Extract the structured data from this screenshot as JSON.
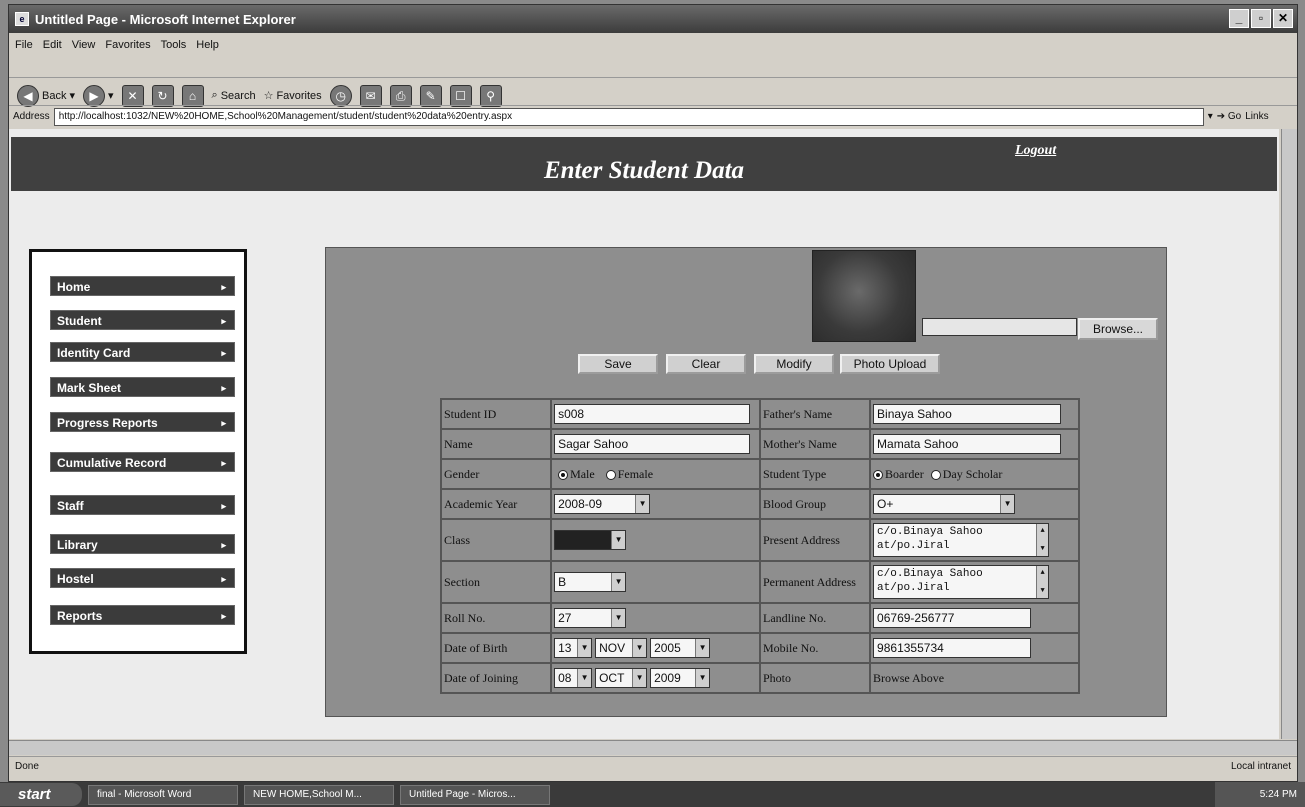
{
  "window": {
    "title": "Untitled Page - Microsoft Internet Explorer"
  },
  "menu": [
    "File",
    "Edit",
    "View",
    "Favorites",
    "Tools",
    "Help"
  ],
  "toolbar": {
    "back": "Back",
    "search": "Search",
    "favorites": "Favorites"
  },
  "address": {
    "label": "Address",
    "url": "http://localhost:1032/NEW%20HOME,School%20Management/student/student%20data%20entry.aspx",
    "go": "Go",
    "links": "Links"
  },
  "page": {
    "title": "Enter Student Data",
    "logout": "Logout"
  },
  "sidebar": {
    "items": [
      {
        "label": "Home"
      },
      {
        "label": "Student"
      },
      {
        "label": "Identity Card"
      },
      {
        "label": "Mark Sheet"
      },
      {
        "label": "Progress Reports"
      },
      {
        "label": "Cumulative Record"
      },
      {
        "label": "Staff"
      },
      {
        "label": "Library"
      },
      {
        "label": "Hostel"
      },
      {
        "label": "Reports"
      }
    ]
  },
  "photo": {
    "browse": "Browse..."
  },
  "buttons": {
    "save": "Save",
    "clear": "Clear",
    "modify": "Modify",
    "photo_upload": "Photo Upload"
  },
  "form": {
    "student_id": {
      "label": "Student ID",
      "value": "s008"
    },
    "name": {
      "label": "Name",
      "value": "Sagar  Sahoo"
    },
    "gender": {
      "label": "Gender",
      "options": [
        "Male",
        "Female"
      ],
      "selected": "Male"
    },
    "academic_year": {
      "label": "Academic Year",
      "value": "2008-09"
    },
    "class": {
      "label": "Class",
      "value": ""
    },
    "section": {
      "label": "Section",
      "value": "B"
    },
    "roll_no": {
      "label": "Roll No.",
      "value": "27"
    },
    "dob": {
      "label": "Date of Birth",
      "day": "13",
      "month": "NOV",
      "year": "2005"
    },
    "doj": {
      "label": "Date of Joining",
      "day": "08",
      "month": "OCT",
      "year": "2009"
    },
    "father": {
      "label": "Father's Name",
      "value": "Binaya Sahoo"
    },
    "mother": {
      "label": "Mother's Name",
      "value": "Mamata Sahoo"
    },
    "student_type": {
      "label": "Student Type",
      "options": [
        "Boarder",
        "Day Scholar"
      ],
      "selected": "Boarder"
    },
    "blood_group": {
      "label": "Blood Group",
      "value": "O+"
    },
    "present_address": {
      "label": "Present Address",
      "line1": "c/o.Binaya Sahoo",
      "line2": "at/po.Jiral"
    },
    "permanent_address": {
      "label": "Permanent Address",
      "line1": "c/o.Binaya Sahoo",
      "line2": "at/po.Jiral"
    },
    "landline": {
      "label": "Landline No.",
      "value": "06769-256777"
    },
    "mobile": {
      "label": "Mobile No.",
      "value": "9861355734"
    },
    "photo": {
      "label": "Photo",
      "value": "Browse Above"
    }
  },
  "status": {
    "left": "Done",
    "right": "Local intranet"
  },
  "taskbar": {
    "start": "start",
    "tasks": [
      "final - Microsoft Word",
      "NEW HOME,School M...",
      "Untitled Page - Micros..."
    ],
    "clock": "5:24 PM"
  }
}
